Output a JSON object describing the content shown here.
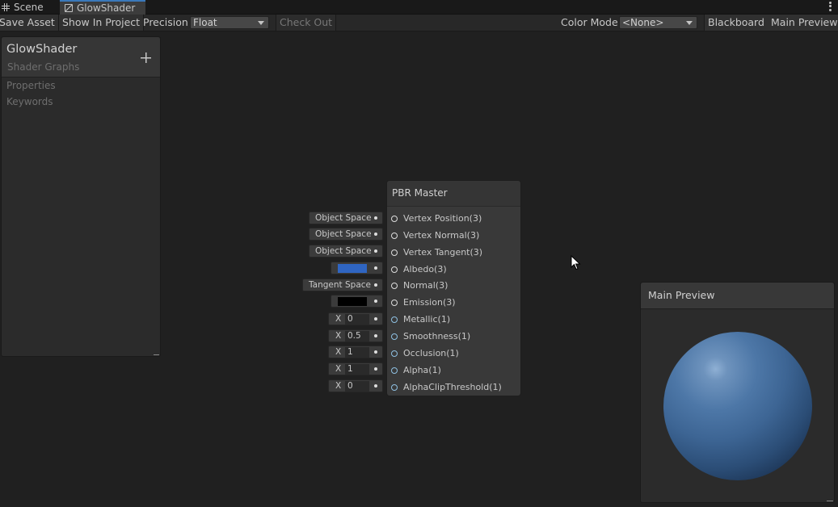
{
  "tabs": [
    {
      "label": "Scene",
      "icon": "grid-icon",
      "active": false
    },
    {
      "label": "GlowShader",
      "icon": "shader-graph-icon",
      "active": true
    }
  ],
  "toolbar": {
    "save_asset": "Save Asset",
    "show_in_project": "Show In Project",
    "precision_label": "Precision",
    "precision_value": "Float",
    "check_out": "Check Out",
    "color_mode_label": "Color Mode",
    "color_mode_value": "<None>",
    "blackboard": "Blackboard",
    "main_preview": "Main Preview"
  },
  "blackboard": {
    "title": "GlowShader",
    "subtitle": "Shader Graphs",
    "sections": [
      "Properties",
      "Keywords"
    ]
  },
  "node": {
    "title": "PBR Master",
    "ports": [
      {
        "label": "Vertex Position(3)",
        "default": "Object Space",
        "kind": "dropdown"
      },
      {
        "label": "Vertex Normal(3)",
        "default": "Object Space",
        "kind": "dropdown"
      },
      {
        "label": "Vertex Tangent(3)",
        "default": "Object Space",
        "kind": "dropdown"
      },
      {
        "label": "Albedo(3)",
        "default": "",
        "kind": "color",
        "color": "#2f65c2"
      },
      {
        "label": "Normal(3)",
        "default": "Tangent Space",
        "kind": "dropdown"
      },
      {
        "label": "Emission(3)",
        "default": "",
        "kind": "color",
        "color": "#000000"
      },
      {
        "label": "Metallic(1)",
        "default": "0",
        "kind": "float",
        "axis": "X"
      },
      {
        "label": "Smoothness(1)",
        "default": "0.5",
        "kind": "float",
        "axis": "X"
      },
      {
        "label": "Occlusion(1)",
        "default": "1",
        "kind": "float",
        "axis": "X"
      },
      {
        "label": "Alpha(1)",
        "default": "1",
        "kind": "float",
        "axis": "X"
      },
      {
        "label": "AlphaClipThreshold(1)",
        "default": "0",
        "kind": "float",
        "axis": "X"
      }
    ]
  },
  "preview": {
    "title": "Main Preview",
    "sphere_color": "#3d6594"
  },
  "colors": {
    "accent": "#3a79bb",
    "canvas": "#202020"
  }
}
